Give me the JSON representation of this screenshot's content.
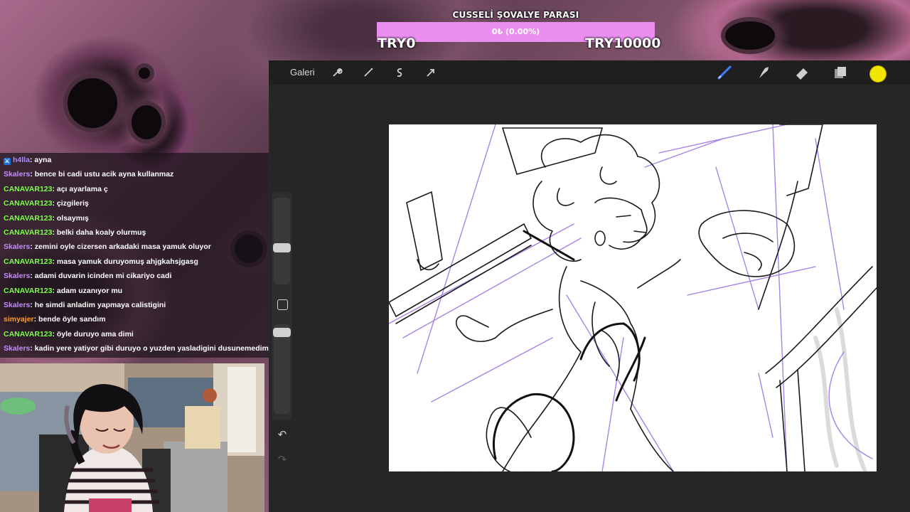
{
  "goal": {
    "title": "CUSSELİ ŞOVALYE PARASI",
    "progress_text": "0₺ (0.00%)",
    "progress_percent": 0,
    "min_label": "TRY0",
    "max_label": "TRY10000",
    "bar_color": "#ea8ef0"
  },
  "toolbar": {
    "gallery_label": "Galeri",
    "left_icons": [
      "wrench-icon",
      "magic-wand-icon",
      "selection-icon",
      "transform-arrow-icon"
    ],
    "right_tools": [
      "brush-icon",
      "smudge-icon",
      "eraser-icon",
      "layers-icon"
    ],
    "current_color": "#f2e600"
  },
  "chat": {
    "messages": [
      {
        "user": "h4lla",
        "user_color": "#a98bff",
        "text": ": ayna",
        "badge": true
      },
      {
        "user": "Skalers",
        "user_color": "#c68cff",
        "text": ": bence bi cadi ustu acik ayna kullanmaz"
      },
      {
        "user": "CANAVAR123",
        "user_color": "#7cff4a",
        "text": ": açı ayarlama ç"
      },
      {
        "user": "CANAVAR123",
        "user_color": "#7cff4a",
        "text": ": çizgileriş"
      },
      {
        "user": "CANAVAR123",
        "user_color": "#7cff4a",
        "text": ": olsaymış"
      },
      {
        "user": "CANAVAR123",
        "user_color": "#7cff4a",
        "text": ": belki daha koaly olurmuş"
      },
      {
        "user": "Skalers",
        "user_color": "#c68cff",
        "text": ": zemini oyle cizersen arkadaki masa yamuk oluyor"
      },
      {
        "user": "CANAVAR123",
        "user_color": "#7cff4a",
        "text": ": masa yamuk duruyomuş ahjgkahsjgasg"
      },
      {
        "user": "Skalers",
        "user_color": "#c68cff",
        "text": ": adami duvarin icinden mi cikariyo cadi"
      },
      {
        "user": "CANAVAR123",
        "user_color": "#7cff4a",
        "text": ": adam uzanıyor mu"
      },
      {
        "user": "Skalers",
        "user_color": "#c68cff",
        "text": ": he simdi anladim yapmaya calistigini"
      },
      {
        "user": "simyajer",
        "user_color": "#ff9a2e",
        "text": ": bende öyle sandım"
      },
      {
        "user": "CANAVAR123",
        "user_color": "#7cff4a",
        "text": ": öyle duruyo ama dimi"
      },
      {
        "user": "Skalers",
        "user_color": "#c68cff",
        "text": ": kadin yere yatiyor gibi duruyo o yuzden yasladigini dusunemedim"
      }
    ]
  }
}
